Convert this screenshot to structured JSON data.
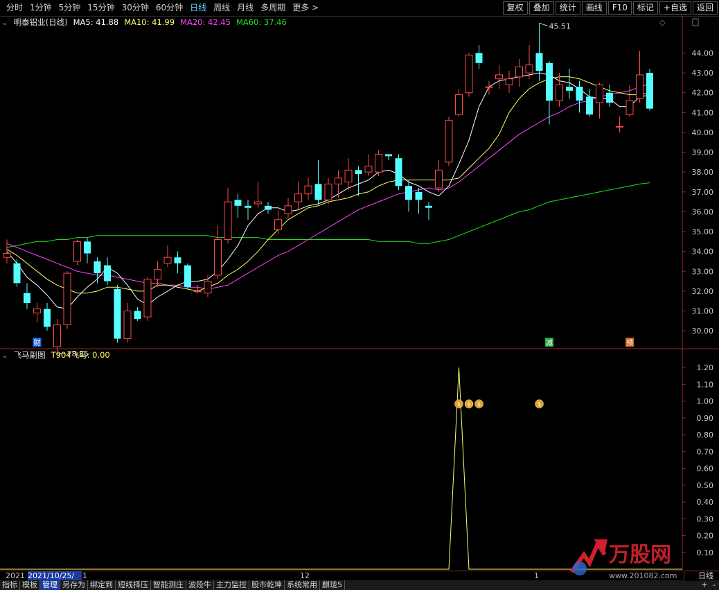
{
  "toolbar": {
    "periods": [
      "分时",
      "1分钟",
      "5分钟",
      "15分钟",
      "30分钟",
      "60分钟",
      "日线",
      "周线",
      "月线",
      "多周期",
      "更多 >"
    ],
    "active_index": 6,
    "right_buttons": [
      "复权",
      "叠加",
      "统计",
      "画线",
      "F10",
      "标记",
      "+自选",
      "返回"
    ]
  },
  "main_header": {
    "stock": "明泰铝业(日线)",
    "ma5": "MA5: 41.88",
    "ma10": "MA10: 41.99",
    "ma20": "MA20: 42.45",
    "ma60": "MA60: 37.46"
  },
  "colors": {
    "up": "#ff4a4a",
    "down": "#54ffff",
    "ma5": "#ffffff",
    "ma10": "#ffff66",
    "ma20": "#ff44ff",
    "ma60": "#22dd22",
    "indicator": "#ffff66",
    "axis": "#8c2b2b"
  },
  "chart_data": {
    "type": "candlestick",
    "y_axis_ticks": [
      "44.00",
      "43.00",
      "42.00",
      "41.00",
      "40.00",
      "39.00",
      "38.00",
      "37.00",
      "36.00",
      "35.00",
      "34.00",
      "33.00",
      "32.00",
      "31.00",
      "30.00"
    ],
    "ylim": [
      29.2,
      45.8
    ],
    "high_label": "45.51",
    "low_label": "28.85",
    "candles": [
      [
        33.7,
        33.9,
        34.6,
        33.4
      ],
      [
        33.4,
        32.4,
        33.6,
        32.2
      ],
      [
        31.9,
        31.4,
        32.4,
        31.1
      ],
      [
        30.9,
        31.1,
        31.4,
        30.4
      ],
      [
        31.1,
        30.2,
        31.4,
        30.0
      ],
      [
        29.2,
        30.3,
        30.6,
        28.85
      ],
      [
        30.3,
        32.9,
        33.0,
        30.1
      ],
      [
        33.5,
        34.5,
        34.6,
        33.3
      ],
      [
        34.5,
        33.9,
        34.7,
        33.4
      ],
      [
        33.5,
        32.9,
        33.7,
        32.4
      ],
      [
        33.3,
        32.5,
        33.7,
        32.3
      ],
      [
        32.1,
        29.6,
        32.3,
        29.4
      ],
      [
        29.6,
        31.0,
        31.4,
        29.4
      ],
      [
        31.0,
        30.6,
        31.2,
        30.5
      ],
      [
        30.7,
        32.6,
        32.7,
        30.5
      ],
      [
        32.6,
        33.1,
        33.5,
        32.2
      ],
      [
        33.4,
        33.7,
        34.3,
        33.2
      ],
      [
        33.7,
        33.4,
        34.0,
        32.9
      ],
      [
        33.3,
        32.2,
        33.4,
        32.1
      ],
      [
        32.0,
        32.0,
        32.3,
        31.9
      ],
      [
        31.9,
        32.5,
        32.8,
        31.7
      ],
      [
        32.8,
        34.6,
        35.3,
        32.6
      ],
      [
        34.6,
        36.5,
        37.2,
        34.4
      ],
      [
        36.6,
        36.3,
        36.9,
        35.7
      ],
      [
        36.3,
        36.2,
        36.6,
        35.6
      ],
      [
        36.4,
        36.5,
        37.5,
        36.2
      ],
      [
        36.3,
        36.1,
        36.5,
        35.9
      ],
      [
        35.1,
        35.6,
        36.1,
        34.9
      ],
      [
        35.9,
        36.3,
        36.7,
        35.7
      ],
      [
        36.5,
        36.9,
        37.5,
        36.1
      ],
      [
        36.9,
        37.3,
        37.7,
        36.6
      ],
      [
        37.4,
        36.6,
        38.6,
        36.4
      ],
      [
        36.6,
        37.4,
        37.7,
        36.4
      ],
      [
        37.4,
        37.7,
        38.1,
        36.7
      ],
      [
        37.5,
        38.1,
        38.7,
        37.1
      ],
      [
        38.1,
        37.9,
        38.3,
        36.8
      ],
      [
        38.0,
        38.3,
        38.9,
        37.8
      ],
      [
        38.0,
        38.9,
        39.1,
        37.8
      ],
      [
        38.9,
        38.8,
        38.9,
        38.6
      ],
      [
        38.7,
        37.3,
        38.9,
        37.1
      ],
      [
        37.3,
        36.6,
        37.6,
        36.0
      ],
      [
        37.0,
        36.6,
        37.2,
        35.9
      ],
      [
        36.3,
        36.2,
        36.5,
        35.6
      ],
      [
        37.2,
        38.1,
        38.6,
        37.0
      ],
      [
        38.5,
        40.6,
        40.8,
        38.3
      ],
      [
        40.9,
        41.9,
        42.2,
        40.8
      ],
      [
        42.0,
        43.9,
        44.0,
        41.8
      ],
      [
        44.0,
        43.5,
        44.4,
        43.2
      ],
      [
        42.3,
        42.3,
        42.6,
        41.9
      ],
      [
        42.7,
        42.9,
        43.4,
        42.2
      ],
      [
        42.4,
        42.7,
        43.1,
        42.0
      ],
      [
        42.8,
        43.3,
        43.7,
        42.3
      ],
      [
        43.0,
        43.4,
        44.4,
        42.7
      ],
      [
        44.0,
        43.1,
        45.51,
        42.6
      ],
      [
        43.5,
        41.6,
        43.6,
        40.4
      ],
      [
        41.6,
        42.4,
        43.0,
        41.3
      ],
      [
        42.3,
        42.1,
        43.2,
        41.7
      ],
      [
        42.3,
        41.6,
        42.6,
        41.0
      ],
      [
        41.8,
        40.9,
        42.2,
        40.8
      ],
      [
        41.5,
        42.4,
        42.5,
        40.7
      ],
      [
        42.0,
        41.5,
        42.4,
        41.3
      ],
      [
        40.3,
        40.3,
        40.8,
        40.0
      ],
      [
        40.9,
        41.6,
        42.4,
        40.8
      ],
      [
        41.7,
        42.9,
        44.1,
        41.5
      ],
      [
        43.0,
        41.2,
        43.2,
        41.1
      ]
    ],
    "ma5": [
      34.0,
      33.4,
      32.7,
      32.3,
      31.8,
      31.2,
      31.1,
      31.7,
      32.2,
      32.6,
      33.2,
      32.9,
      32.3,
      31.6,
      31.3,
      31.7,
      32.0,
      32.3,
      32.5,
      32.5,
      32.6,
      33.0,
      33.6,
      34.3,
      35.3,
      35.9,
      36.2,
      36.2,
      36.0,
      36.1,
      36.3,
      36.4,
      36.6,
      36.9,
      37.2,
      37.4,
      37.6,
      38.0,
      38.1,
      37.9,
      37.5,
      37.3,
      37.0,
      36.8,
      37.3,
      38.4,
      39.6,
      41.3,
      42.3,
      42.6,
      42.7,
      42.8,
      42.9,
      43.0,
      42.9,
      42.6,
      42.5,
      42.2,
      41.8,
      41.7,
      41.7,
      41.3,
      41.3,
      41.8,
      41.88
    ],
    "ma10": [
      34.1,
      33.8,
      33.4,
      33.0,
      32.6,
      32.3,
      32.1,
      31.9,
      31.9,
      32.0,
      32.2,
      32.2,
      32.1,
      32.0,
      32.0,
      32.3,
      32.3,
      32.2,
      32.1,
      32.0,
      32.2,
      32.4,
      32.8,
      33.1,
      33.5,
      34.0,
      34.6,
      35.1,
      35.6,
      35.9,
      36.2,
      36.3,
      36.5,
      36.6,
      36.7,
      36.9,
      37.0,
      37.3,
      37.5,
      37.6,
      37.6,
      37.6,
      37.6,
      37.6,
      37.6,
      37.7,
      38.2,
      38.7,
      39.2,
      39.9,
      41.0,
      41.7,
      42.2,
      42.5,
      42.7,
      42.8,
      42.8,
      42.7,
      42.5,
      42.3,
      42.1,
      42.0,
      41.9,
      41.9,
      41.99
    ],
    "ma20": [
      34.4,
      34.2,
      34.0,
      33.8,
      33.6,
      33.4,
      33.2,
      33.0,
      32.9,
      32.8,
      32.8,
      32.7,
      32.6,
      32.5,
      32.4,
      32.4,
      32.3,
      32.3,
      32.2,
      32.2,
      32.1,
      32.2,
      32.3,
      32.6,
      32.9,
      33.2,
      33.5,
      33.8,
      34.0,
      34.3,
      34.6,
      34.9,
      35.2,
      35.5,
      35.8,
      36.1,
      36.3,
      36.5,
      36.7,
      36.9,
      37.0,
      37.1,
      37.2,
      37.1,
      37.2,
      37.5,
      37.9,
      38.3,
      38.7,
      39.1,
      39.5,
      39.9,
      40.2,
      40.5,
      40.8,
      41.0,
      41.3,
      41.5,
      41.6,
      41.8,
      41.9,
      42.0,
      42.1,
      42.3,
      42.45
    ],
    "ma60": [
      34.2,
      34.3,
      34.4,
      34.5,
      34.5,
      34.6,
      34.6,
      34.7,
      34.7,
      34.8,
      34.8,
      34.8,
      34.8,
      34.8,
      34.8,
      34.8,
      34.8,
      34.8,
      34.8,
      34.8,
      34.8,
      34.7,
      34.7,
      34.7,
      34.7,
      34.7,
      34.6,
      34.6,
      34.6,
      34.6,
      34.6,
      34.6,
      34.6,
      34.6,
      34.6,
      34.6,
      34.6,
      34.5,
      34.5,
      34.5,
      34.5,
      34.4,
      34.4,
      34.5,
      34.6,
      34.8,
      35.0,
      35.2,
      35.4,
      35.6,
      35.8,
      36.0,
      36.1,
      36.3,
      36.5,
      36.6,
      36.7,
      36.8,
      36.9,
      37.0,
      37.1,
      37.2,
      37.3,
      37.4,
      37.46
    ],
    "markers": [
      {
        "candle": 3,
        "text": "财",
        "color": "#2266dd"
      },
      {
        "candle": 54,
        "text": "减",
        "color": "#22aa44"
      },
      {
        "candle": 62,
        "text": "预",
        "color": "#cc6622"
      }
    ]
  },
  "sub_chart": {
    "title": "飞马副图",
    "indicator_label": "T904飞马: 0.00",
    "y_ticks": [
      "1.20",
      "1.10",
      "1.00",
      "0.90",
      "0.80",
      "0.70",
      "0.60",
      "0.50",
      "0.40",
      "0.30",
      "0.20",
      "0.10"
    ],
    "ylim": [
      0,
      1.25
    ],
    "spike": {
      "candle": 45,
      "value": 1.2
    },
    "money_bag_candles": [
      45,
      46,
      47,
      53
    ]
  },
  "date_bar": {
    "items": [
      "2021",
      "2021/10/25/一",
      "1",
      "12",
      "1",
      "日线"
    ]
  },
  "bottom_tabs": [
    "指标",
    "模板",
    "管理",
    "另存为",
    "绑定到",
    "短线择压",
    "智能测庄",
    "波段牛",
    "主力监控",
    "股市乾坤",
    "系统常用",
    "麒珑5"
  ],
  "bottom_active": 2,
  "bottom_right": {
    "plus": "+",
    "minus": "-"
  },
  "watermark": {
    "brand": "万股网",
    "url": "www.201082.com"
  }
}
